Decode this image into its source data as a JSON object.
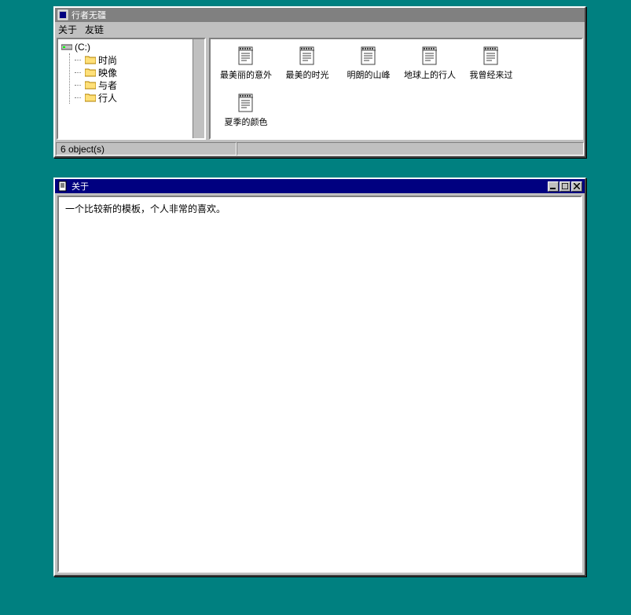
{
  "explorer": {
    "title": "行者无疆",
    "menu": [
      "关于",
      "友链"
    ],
    "tree": {
      "root": "(C:)",
      "folders": [
        "时尚",
        "映像",
        "与者",
        "行人"
      ]
    },
    "files": [
      "最美丽的意外",
      "最美的时光",
      "明朗的山峰",
      "地球上的行人",
      "我曾经来过",
      "夏季的颜色"
    ],
    "status": "6 object(s)"
  },
  "about": {
    "title": "关于",
    "content": "一个比较新的模板，个人非常的喜欢。"
  },
  "icons": {
    "system": "▣",
    "doc": "≡"
  }
}
